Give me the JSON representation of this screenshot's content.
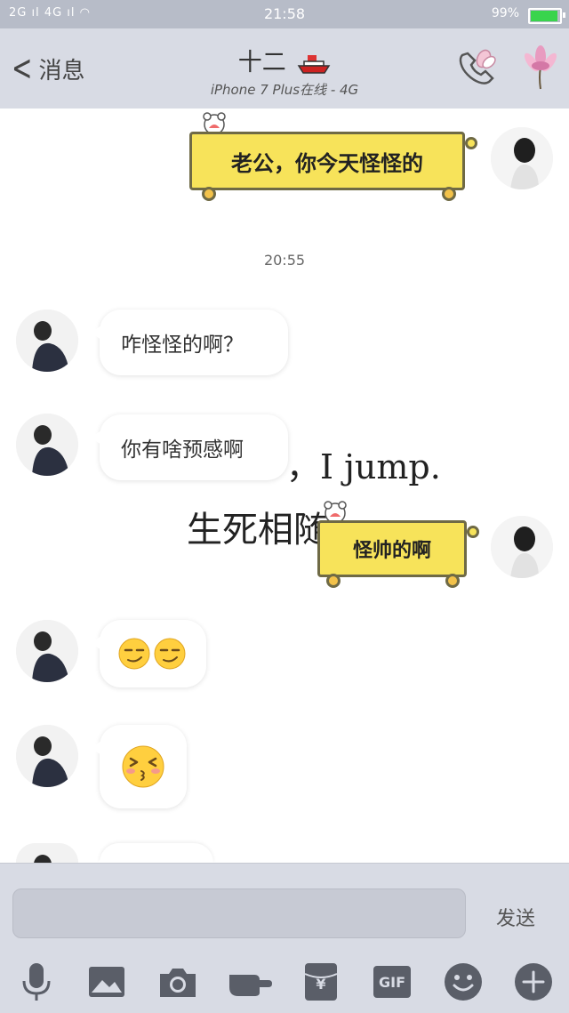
{
  "status_bar": {
    "signal": "2G▕▕ıl 4G▕ıl",
    "time": "21:58",
    "battery_pct": "99%",
    "battery_level": 0.99
  },
  "nav": {
    "back_label": "消息",
    "title": "十二",
    "subtitle": "iPhone 7 Plus在线 - 4G"
  },
  "messages": [
    {
      "side": "me",
      "text": "老公，你今天怪怪的"
    },
    {
      "side": "system",
      "text": "20:55"
    },
    {
      "side": "them",
      "text": "咋怪怪的啊？"
    },
    {
      "side": "them",
      "text": "你有啥预感啊"
    },
    {
      "side": "me",
      "text": "怪帅的啊"
    },
    {
      "side": "them",
      "emojis": [
        "smirk",
        "smirk"
      ]
    },
    {
      "side": "them",
      "emojis": [
        "kiss"
      ]
    }
  ],
  "background_text": {
    "line1": "，I jump.",
    "line2": "生死相随"
  },
  "input": {
    "placeholder": "",
    "send_label": "发送"
  },
  "toolbar": {
    "items": [
      "mic-icon",
      "image-icon",
      "camera-icon",
      "poke-icon",
      "redpacket-icon",
      "gif-icon",
      "emoji-icon",
      "plus-icon"
    ],
    "gif_label": "GIF",
    "redpacket_label": "¥"
  },
  "colors": {
    "nav_bg": "#d8dbe4",
    "cart_yellow": "#f7e35a",
    "battery_green": "#39d44d"
  }
}
